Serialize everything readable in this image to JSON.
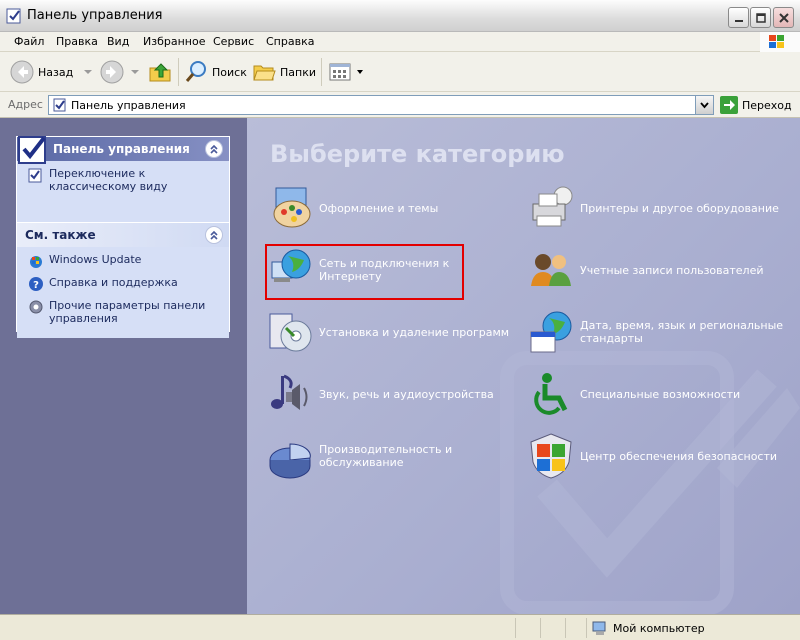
{
  "window": {
    "title": "Панель управления"
  },
  "menu": [
    "Файл",
    "Правка",
    "Вид",
    "Избранное",
    "Сервис",
    "Справка"
  ],
  "toolbar": {
    "back": "Назад",
    "search": "Поиск",
    "folders": "Папки"
  },
  "address": {
    "label": "Адрес",
    "value": "Панель управления",
    "go": "Переход"
  },
  "sidebar": {
    "control_panel": {
      "title": "Панель управления",
      "links": [
        {
          "label": "Переключение к классическому виду",
          "icon": "classic-view-icon"
        }
      ]
    },
    "see_also": {
      "title": "См. также",
      "links": [
        {
          "label": "Windows Update",
          "icon": "windows-update-icon"
        },
        {
          "label": "Справка и поддержка",
          "icon": "help-icon"
        },
        {
          "label": "Прочие параметры панели управления",
          "icon": "gear-icon"
        }
      ]
    }
  },
  "main": {
    "heading": "Выберите категорию",
    "categories": [
      {
        "label": "Оформление и темы",
        "icon": "appearance-icon"
      },
      {
        "label": "Принтеры и другое оборудование",
        "icon": "printer-icon"
      },
      {
        "label": "Сеть и подключения к Интернету",
        "icon": "network-icon"
      },
      {
        "label": "Учетные записи пользователей",
        "icon": "users-icon"
      },
      {
        "label": "Установка и удаление программ",
        "icon": "add-remove-icon"
      },
      {
        "label": "Дата, время, язык и региональные стандарты",
        "icon": "date-time-icon"
      },
      {
        "label": "Звук, речь и аудиоустройства",
        "icon": "sound-icon"
      },
      {
        "label": "Специальные возможности",
        "icon": "accessibility-icon"
      },
      {
        "label": "Производительность и обслуживание",
        "icon": "performance-icon"
      },
      {
        "label": "Центр обеспечения безопасности",
        "icon": "security-shield-icon"
      }
    ]
  },
  "status": {
    "zone": "Мой компьютер"
  },
  "colors": {
    "content_bg": "#6e7096",
    "panel_bg": "#d6dff6",
    "highlight": "#e30000"
  }
}
